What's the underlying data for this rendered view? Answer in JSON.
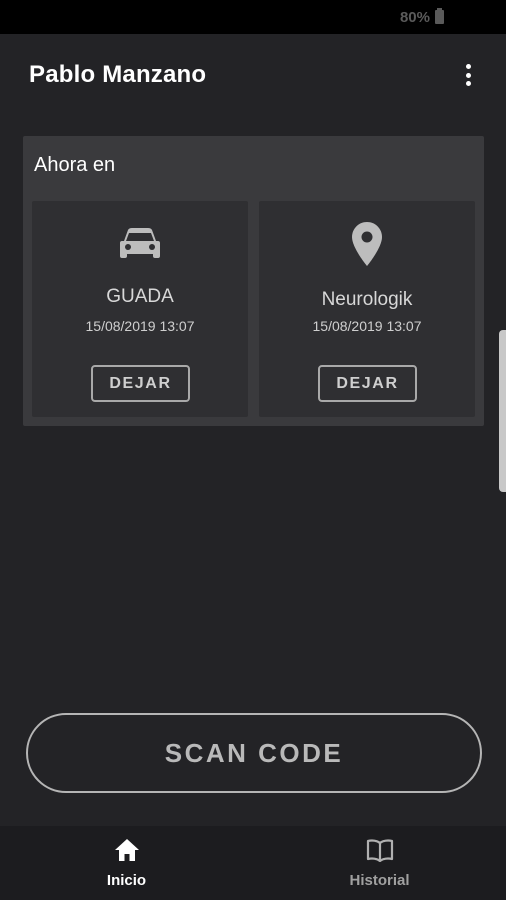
{
  "status_bar": {
    "battery": "80%"
  },
  "header": {
    "title": "Pablo Manzano",
    "menu_icon": "more-vert-icon"
  },
  "now_section": {
    "title": "Ahora en",
    "places": [
      {
        "icon": "car-icon",
        "name": "GUADA",
        "time": "15/08/2019 13:07",
        "action": "DEJAR"
      },
      {
        "icon": "location-pin-icon",
        "name": "Neurologik",
        "time": "15/08/2019 13:07",
        "action": "DEJAR"
      }
    ]
  },
  "scan": {
    "label": "SCAN CODE"
  },
  "bottom_nav": {
    "items": [
      {
        "label": "Inicio",
        "icon": "home-icon",
        "active": true
      },
      {
        "label": "Historial",
        "icon": "book-icon",
        "active": false
      }
    ]
  },
  "colors": {
    "background": "#232326",
    "card": "#3a3a3d",
    "inner_card": "#2f2f32",
    "outline": "#a9a9a9",
    "nav_background": "#1c1c1f"
  }
}
